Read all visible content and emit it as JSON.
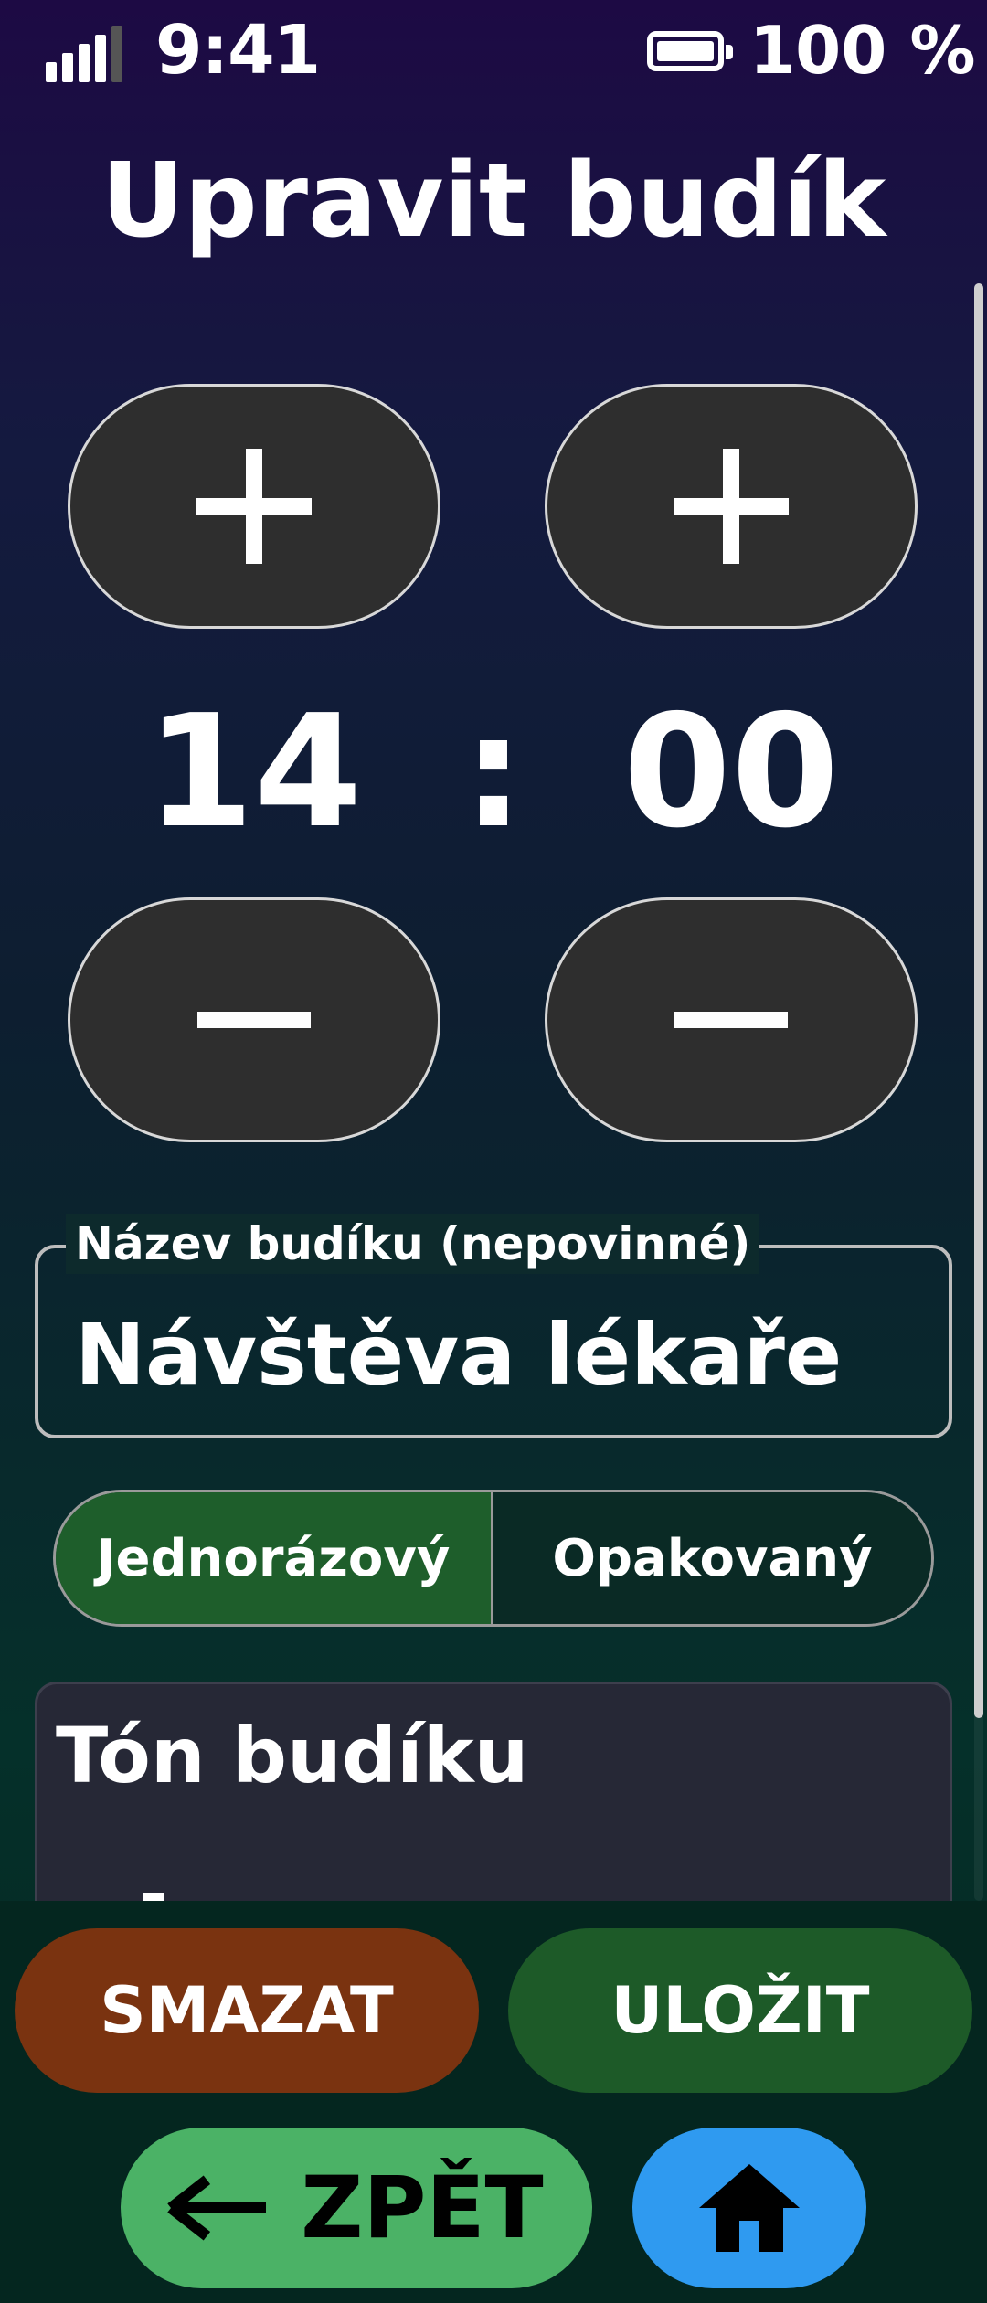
{
  "status_bar": {
    "time": "9:41",
    "battery": "100 %",
    "icons": [
      "signal-icon",
      "battery-icon"
    ]
  },
  "title": "Upravit budík",
  "time_picker": {
    "hours": "14",
    "separator": ":",
    "minutes": "00",
    "increase_icon": "plus-icon",
    "decrease_icon": "minus-icon"
  },
  "name_field": {
    "label": "Název budíku (nepovinné)",
    "value": "Návštěva lékaře"
  },
  "repeat_mode": {
    "options": [
      "Jednorázový",
      "Opakovaný"
    ],
    "selected": "Jednorázový"
  },
  "tone": {
    "title": "Tón budíku"
  },
  "actions": {
    "delete_label": "SMAZAT",
    "save_label": "ULOŽIT",
    "back_label": "ZPĚT",
    "home_icon": "home-icon"
  },
  "colors": {
    "delete": "#7a3310",
    "save": "#1d5a28",
    "back": "#4bb266",
    "home": "#2f9af0",
    "segment_selected": "#1e5e2b",
    "stepper": "#2e2e2e"
  }
}
